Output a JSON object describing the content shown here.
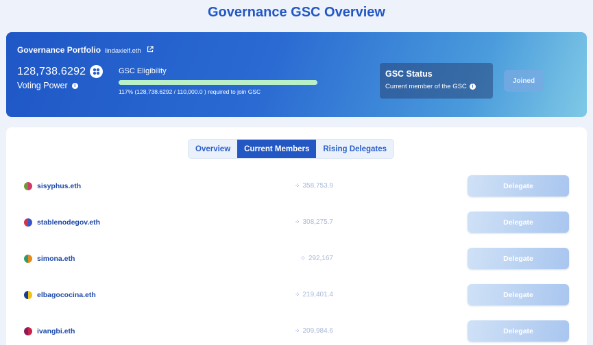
{
  "page": {
    "title": "Governance GSC Overview"
  },
  "portfolio": {
    "title": "Governance Portfolio",
    "ens": "lindaxielf.eth",
    "voting_power_amount": "128,738.6292",
    "voting_power_label": "Voting Power",
    "eligibility_title": "GSC Eligibility",
    "eligibility_progress": 1.0,
    "eligibility_note": "117% (128,738.6292 / 110,000.0 ) required to join GSC",
    "status_title": "GSC Status",
    "status_sub": "Current member of the GSC",
    "joined_label": "Joined"
  },
  "tabs": [
    {
      "label": "Overview",
      "active": false
    },
    {
      "label": "Current Members",
      "active": true
    },
    {
      "label": "Rising Delegates",
      "active": false
    }
  ],
  "members": [
    {
      "name": "sisyphus.eth",
      "power": "358,753.9",
      "delegate_label": "Delegate",
      "avatar_colors": [
        "#d23a6a",
        "#6a9a3a"
      ]
    },
    {
      "name": "stablenodegov.eth",
      "power": "308,275.7",
      "delegate_label": "Delegate",
      "avatar_colors": [
        "#3a55c8",
        "#d2324a"
      ]
    },
    {
      "name": "simona.eth",
      "power": "292,167",
      "delegate_label": "Delegate",
      "avatar_colors": [
        "#e58a1f",
        "#2f9a6a"
      ]
    },
    {
      "name": "elbagococina.eth",
      "power": "219,401.4",
      "delegate_label": "Delegate",
      "avatar_colors": [
        "#f2c21a",
        "#1a3f8a"
      ]
    },
    {
      "name": "ivangbi.eth",
      "power": "209,984.6",
      "delegate_label": "Delegate",
      "avatar_colors": [
        "#c8244a",
        "#8a1a5a"
      ]
    }
  ]
}
